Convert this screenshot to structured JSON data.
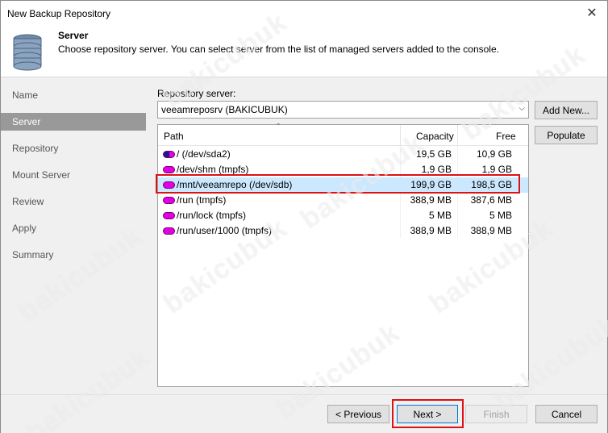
{
  "window": {
    "title": "New Backup Repository",
    "close_glyph": "✕"
  },
  "header": {
    "title": "Server",
    "subtitle": "Choose repository server. You can select server from the list of managed servers added to the console."
  },
  "nav": {
    "items": [
      {
        "label": "Name",
        "active": false
      },
      {
        "label": "Server",
        "active": true
      },
      {
        "label": "Repository",
        "active": false
      },
      {
        "label": "Mount Server",
        "active": false
      },
      {
        "label": "Review",
        "active": false
      },
      {
        "label": "Apply",
        "active": false
      },
      {
        "label": "Summary",
        "active": false
      }
    ]
  },
  "repository": {
    "label": "Repository server:",
    "selected": "veeamreposrv (BAKICUBUK)",
    "add_new_label": "Add New...",
    "populate_label": "Populate"
  },
  "table": {
    "columns": [
      "Path",
      "Capacity",
      "Free"
    ],
    "rows": [
      {
        "path": "/ (/dev/sda2)",
        "capacity": "19,5 GB",
        "free": "10,9 GB",
        "selected": false
      },
      {
        "path": "/dev/shm (tmpfs)",
        "capacity": "1,9 GB",
        "free": "1,9 GB",
        "selected": false
      },
      {
        "path": "/mnt/veeamrepo (/dev/sdb)",
        "capacity": "199,9 GB",
        "free": "198,5 GB",
        "selected": true
      },
      {
        "path": "/run (tmpfs)",
        "capacity": "388,9 MB",
        "free": "387,6 MB",
        "selected": false
      },
      {
        "path": "/run/lock (tmpfs)",
        "capacity": "5 MB",
        "free": "5 MB",
        "selected": false
      },
      {
        "path": "/run/user/1000 (tmpfs)",
        "capacity": "388,9 MB",
        "free": "388,9 MB",
        "selected": false
      }
    ]
  },
  "footer": {
    "previous_label": "< Previous",
    "next_label": "Next >",
    "finish_label": "Finish",
    "cancel_label": "Cancel"
  },
  "watermark": "bakicubuk",
  "colors": {
    "selection": "#cce8ff",
    "nav_active": "#999999",
    "highlight": "#dd1111"
  }
}
